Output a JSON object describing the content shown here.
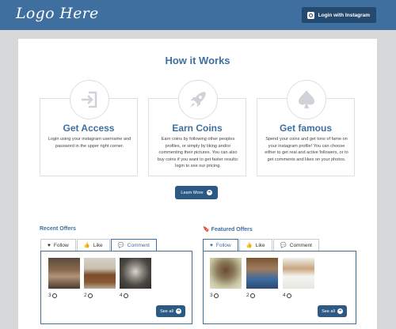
{
  "header": {
    "logo": "Logo Here",
    "login_label": "Login with Instagram"
  },
  "how": {
    "title": "How it Works"
  },
  "features": [
    {
      "title": "Get Access",
      "text": "Login using your instagram username and password in the upper right corner.",
      "icon": "sign-in-icon"
    },
    {
      "title": "Earn Coins",
      "text": "Earn coins by following other peoples profiles, or simply by liking and/or commenting their pictures. You can also buy coins if you want to get faster results: login to see our pricing.",
      "icon": "rocket-icon"
    },
    {
      "title": "Get famous",
      "text": "Spend your coins and get tons of fame on your instagram profile! You can choose either to get real and active followers, or to get comments and likes on your photos.",
      "icon": "spade-icon"
    }
  ],
  "learn_more": "Learn More",
  "recent": {
    "title": "Recent Offers",
    "tabs": [
      "Follow",
      "Like",
      "Comment"
    ],
    "active_tab": "Comment",
    "items": [
      {
        "count": "3"
      },
      {
        "count": "2"
      },
      {
        "count": "4"
      }
    ],
    "see_all": "See all"
  },
  "featured": {
    "title": "Featured Offers",
    "tabs": [
      "Follow",
      "Like",
      "Comment"
    ],
    "active_tab": "Follow",
    "items": [
      {
        "count": "3"
      },
      {
        "count": "2"
      },
      {
        "count": "4"
      }
    ],
    "see_all": "See all"
  },
  "colors": {
    "brand": "#3f6f9f",
    "button": "#2d5a85",
    "header": "#3f6f9f",
    "background": "#d6d8da"
  }
}
